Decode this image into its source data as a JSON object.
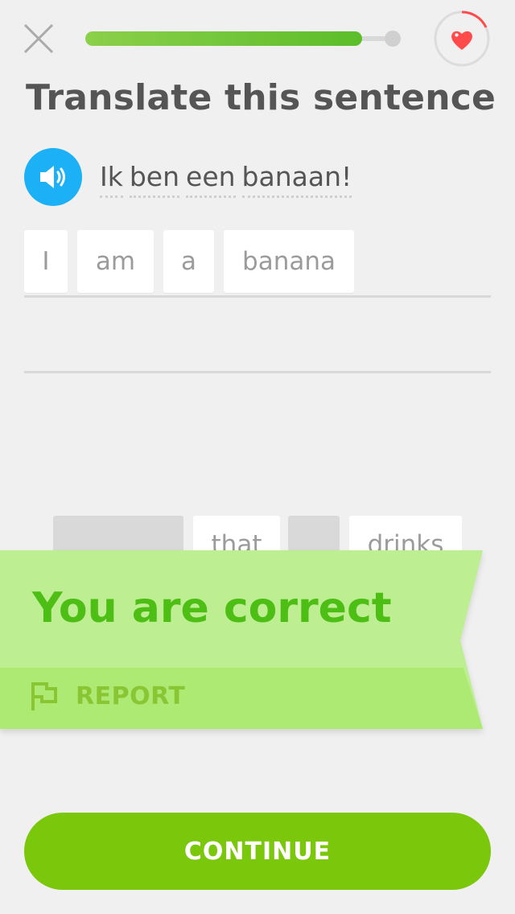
{
  "header": {
    "close_icon": "close-icon",
    "progress": 0.9,
    "heart_icon": "heart-icon"
  },
  "prompt": {
    "title": "Translate this sentence",
    "speaker_icon": "speaker-icon",
    "sentence_words": [
      "Ik",
      "ben",
      "een",
      "banaan!"
    ]
  },
  "answer": {
    "tiles": [
      "I",
      "am",
      "a",
      "banana"
    ]
  },
  "word_bank": {
    "visible_words": [
      "that",
      "drinks"
    ]
  },
  "feedback": {
    "message": "You are correct",
    "report_label": "REPORT",
    "report_icon": "flag-icon",
    "colors": {
      "banner_light": "#bdee92",
      "banner_dark": "#acea74",
      "text": "#4cbe14"
    }
  },
  "footer": {
    "continue_label": "CONTINUE",
    "color": "#7ac70c"
  }
}
